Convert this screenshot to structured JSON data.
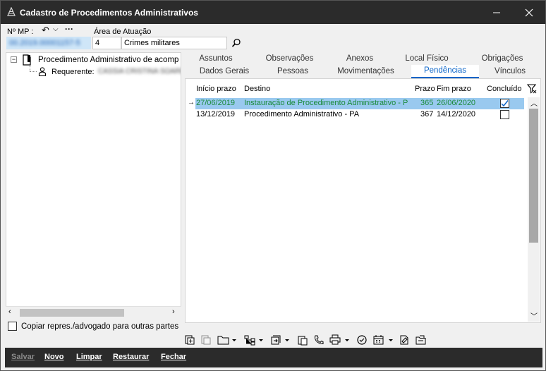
{
  "window": {
    "title": "Cadastro de Procedimentos Administrativos"
  },
  "form": {
    "mp_label": "Nº MP :",
    "mp_value": "00.2019.00001157-5",
    "area_label": "Área de Atuação",
    "area_code": "4",
    "area_name": "Crimes militares"
  },
  "tree": {
    "root_label": "Procedimento Administrativo de acomp",
    "child_label": "Requerente:",
    "child_value": "CASSIA CRISTINA SOARES"
  },
  "copy_checkbox": {
    "label": "Copiar repres./advogado para outras partes",
    "checked": false
  },
  "tabs": {
    "row1": [
      "Assuntos",
      "Observações",
      "Anexos",
      "Local Físico",
      "Obrigações"
    ],
    "row2": [
      "Dados Gerais",
      "Pessoas",
      "Movimentações",
      "Pendências",
      "Vínculos"
    ],
    "active": "Pendências"
  },
  "grid": {
    "columns": [
      "Início prazo",
      "Destino",
      "Prazo",
      "Fim prazo",
      "Concluído"
    ],
    "rows": [
      {
        "inicio": "27/06/2019",
        "destino": "Instauração de Procedimento Administrativo - P",
        "prazo": "365",
        "fim": "26/06/2020",
        "concluido": true,
        "selected": true
      },
      {
        "inicio": "13/12/2019",
        "destino": "Procedimento Administrativo - PA",
        "prazo": "367",
        "fim": "14/12/2020",
        "concluido": false,
        "selected": false
      }
    ]
  },
  "bottom_buttons": {
    "salvar": "Salvar",
    "novo": "Novo",
    "limpar": "Limpar",
    "restaurar": "Restaurar",
    "fechar": "Fechar"
  },
  "colors": {
    "titlebar": "#2b2b2b",
    "selected_row": "#99c9ef",
    "selected_text": "#1a8a3a",
    "accent": "#0a64c8"
  }
}
